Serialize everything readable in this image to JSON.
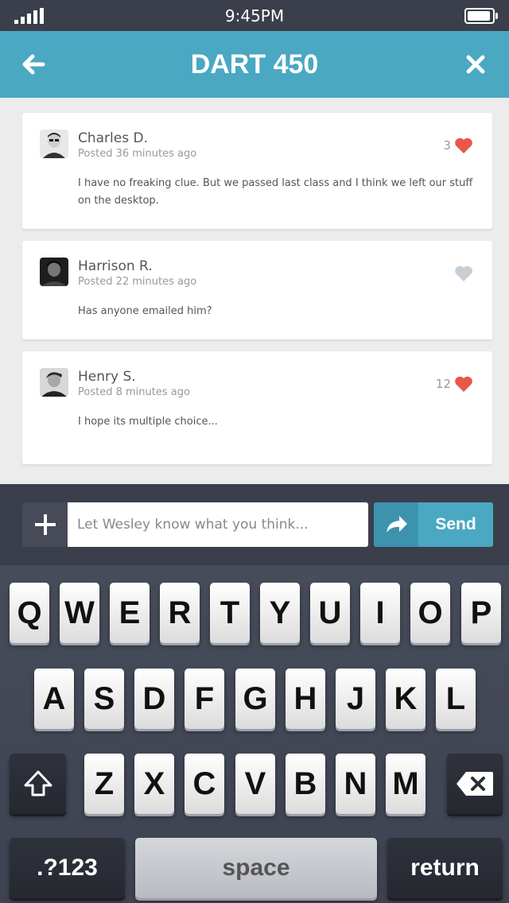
{
  "status_bar": {
    "time": "9:45PM"
  },
  "header": {
    "title": "DART 450"
  },
  "comments": [
    {
      "name": "Charles D.",
      "posted": "Posted 36 minutes ago",
      "text": "I have no freaking clue. But we passed last class and I think we left our stuff on the desktop.",
      "likes": "3",
      "liked": true
    },
    {
      "name": "Harrison R.",
      "posted": "Posted 22 minutes ago",
      "text": "Has anyone emailed him?",
      "likes": "",
      "liked": false
    },
    {
      "name": "Henry S.",
      "posted": "Posted 8 minutes ago",
      "text": "I hope its multiple choice...",
      "likes": "12",
      "liked": true
    }
  ],
  "compose": {
    "placeholder": "Let Wesley know what you think...",
    "send_label": "Send"
  },
  "keyboard": {
    "row1": [
      "Q",
      "W",
      "E",
      "R",
      "T",
      "Y",
      "U",
      "I",
      "O",
      "P"
    ],
    "row2": [
      "A",
      "S",
      "D",
      "F",
      "G",
      "H",
      "J",
      "K",
      "L"
    ],
    "row3": [
      "Z",
      "X",
      "C",
      "V",
      "B",
      "N",
      "M"
    ],
    "numbers_label": ".?123",
    "space_label": "space",
    "return_label": "return"
  },
  "colors": {
    "accent": "#4aa8c3",
    "heart_liked": "#e8574a",
    "heart_unliked": "#c6ced6"
  }
}
